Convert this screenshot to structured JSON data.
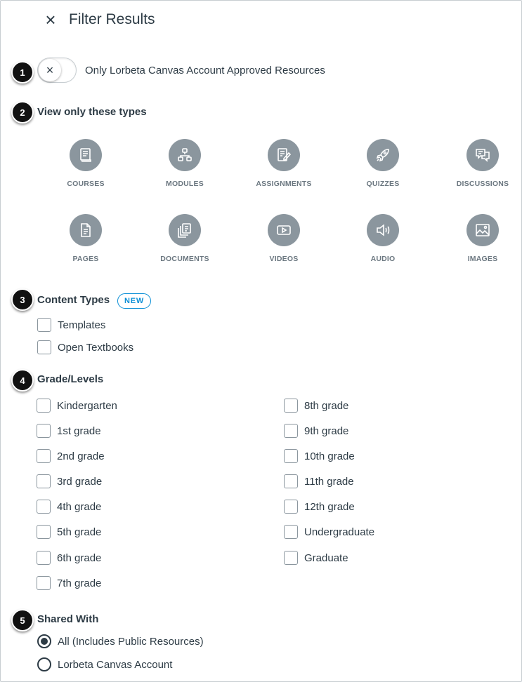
{
  "header": {
    "close_glyph": "×",
    "title": "Filter Results"
  },
  "markers": [
    "1",
    "2",
    "3",
    "4",
    "5"
  ],
  "approved_toggle": {
    "label": "Only Lorbeta Canvas Account Approved Resources",
    "checked": false,
    "knob_glyph": "×"
  },
  "types_section": {
    "heading": "View only these types",
    "types": [
      {
        "label": "COURSES",
        "icon": "course-icon"
      },
      {
        "label": "MODULES",
        "icon": "modules-icon"
      },
      {
        "label": "ASSIGNMENTS",
        "icon": "assignment-icon"
      },
      {
        "label": "QUIZZES",
        "icon": "quiz-rocket-icon"
      },
      {
        "label": "DISCUSSIONS",
        "icon": "discussion-icon"
      },
      {
        "label": "PAGES",
        "icon": "page-icon"
      },
      {
        "label": "DOCUMENTS",
        "icon": "documents-icon"
      },
      {
        "label": "VIDEOS",
        "icon": "video-icon"
      },
      {
        "label": "AUDIO",
        "icon": "audio-icon"
      },
      {
        "label": "IMAGES",
        "icon": "image-icon"
      }
    ]
  },
  "content_types": {
    "heading": "Content Types",
    "badge": "NEW",
    "options": [
      "Templates",
      "Open Textbooks"
    ]
  },
  "grade_levels": {
    "heading": "Grade/Levels",
    "left_column": [
      "Kindergarten",
      "1st grade",
      "2nd grade",
      "3rd grade",
      "4th grade",
      "5th grade",
      "6th grade",
      "7th grade"
    ],
    "right_column": [
      "8th grade",
      "9th grade",
      "10th grade",
      "11th grade",
      "12th grade",
      "Undergraduate",
      "Graduate"
    ]
  },
  "shared_with": {
    "heading": "Shared With",
    "options": [
      {
        "label": "All (Includes Public Resources)",
        "selected": true
      },
      {
        "label": "Lorbeta Canvas Account",
        "selected": false
      }
    ]
  },
  "colors": {
    "icon_circle": "#8b969e",
    "accent": "#0b8fd6",
    "text": "#2d3b45",
    "marker": "#111111"
  }
}
